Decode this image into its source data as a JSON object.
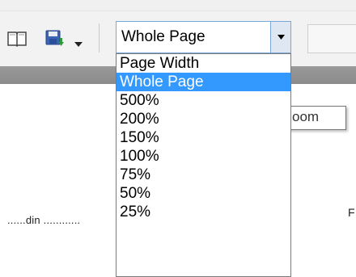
{
  "toolbar": {
    "icons": {
      "book": "book-icon",
      "save": "save-icon",
      "dropdown_arrow": "chevron-down-icon"
    },
    "zoom_combo": {
      "value": "Whole Page"
    }
  },
  "zoom_dropdown": {
    "options": [
      "Page Width",
      "Whole Page",
      "500%",
      "200%",
      "150%",
      "100%",
      "75%",
      "50%",
      "25%"
    ],
    "selected_index": 1
  },
  "tooltip": {
    "text": "oom"
  },
  "document": {
    "dotted_text": "......din ............",
    "right_letter": "F"
  },
  "colors": {
    "selection": "#3399ff",
    "combo_border": "#7aa7d8",
    "band": "#8f8f8f"
  }
}
